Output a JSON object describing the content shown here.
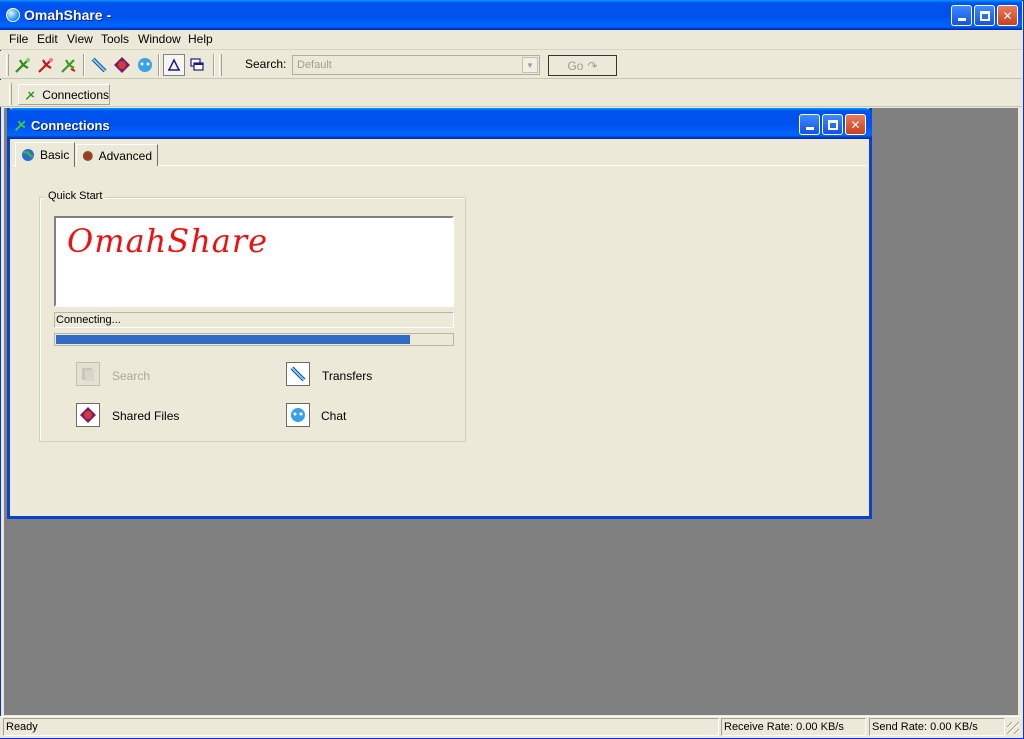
{
  "app": {
    "title": "OmahShare -"
  },
  "menu": [
    "File",
    "Edit",
    "View",
    "Tools",
    "Window",
    "Help"
  ],
  "toolbar": {
    "search_label": "Search:",
    "search_value": "Default",
    "go_label": "Go"
  },
  "window_toolbar": {
    "connections_label": "Connections"
  },
  "child": {
    "title": "Connections",
    "tabs": [
      "Basic",
      "Advanced"
    ],
    "quick_start": {
      "label": "Quick Start",
      "logo_text": "OmahShare",
      "status_text": "Connecting...",
      "progress": 0.895,
      "actions": {
        "search": "Search",
        "transfers": "Transfers",
        "shared_files": "Shared Files",
        "chat": "Chat"
      }
    }
  },
  "statusbar": {
    "state": "Ready",
    "receive_rate": "Receive Rate:  0.00 KB/s",
    "send_rate": "Send Rate:  0.00 KB/s"
  },
  "colors": {
    "titlebar": "#0053ee",
    "progress": "#316ac5",
    "logo": "#ee1111",
    "mdi_background": "#808080"
  }
}
